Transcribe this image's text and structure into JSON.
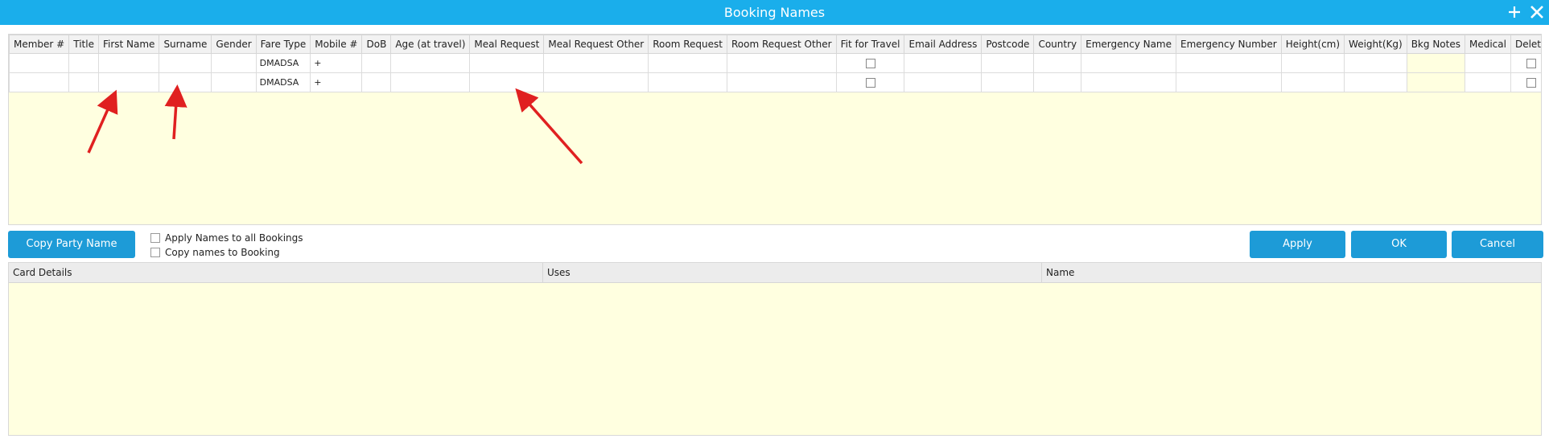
{
  "window": {
    "title": "Booking Names"
  },
  "names_grid": {
    "columns": [
      "Member #",
      "Title",
      "First Name",
      "Surname",
      "Gender",
      "Fare Type",
      "Mobile #",
      "DoB",
      "Age (at travel)",
      "Meal Request",
      "Meal Request Other",
      "Room Request",
      "Room Request Other",
      "Fit for Travel",
      "Email Address",
      "Postcode",
      "Country",
      "Emergency Name",
      "Emergency Number",
      "Height(cm)",
      "Weight(Kg)",
      "Bkg Notes",
      "Medical",
      "Delete"
    ],
    "rows": [
      {
        "fare_type": "DMADSA",
        "mobile": "+",
        "fit_for_travel": false,
        "delete": false
      },
      {
        "fare_type": "DMADSA",
        "mobile": "+",
        "fit_for_travel": false,
        "delete": false
      }
    ]
  },
  "actions": {
    "copy_party_name": "Copy Party Name",
    "apply_names_all": "Apply Names to all Bookings",
    "copy_names_booking": "Copy names to Booking",
    "apply": "Apply",
    "ok": "OK",
    "cancel": "Cancel"
  },
  "card_grid": {
    "columns": [
      "Card Details",
      "Uses",
      "Name"
    ]
  },
  "colors": {
    "titlebar": "#1aaeeb",
    "button": "#1d9bd7",
    "grid_background": "#ffffe0",
    "annotation_arrow": "#e02020"
  },
  "icons": {
    "add": "plus-icon",
    "close": "close-icon"
  }
}
